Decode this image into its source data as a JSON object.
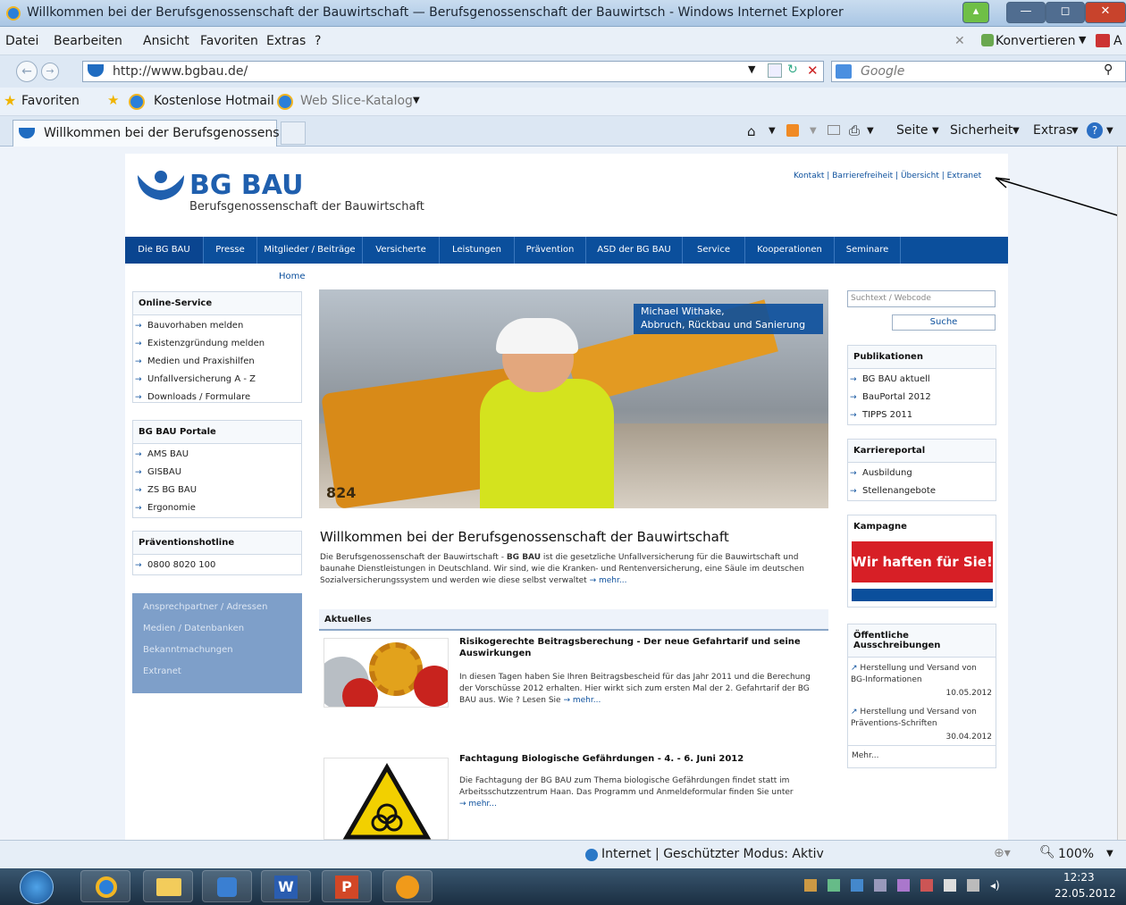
{
  "window": {
    "title": "Willkommen bei der Berufsgenossenschaft der Bauwirtschaft — Berufsgenossenschaft der Bauwirtsch - Windows Internet Explorer"
  },
  "menu": {
    "items": [
      "Datei",
      "Bearbeiten",
      "Ansicht",
      "Favoriten",
      "Extras",
      "?"
    ],
    "convert": "Konvertieren",
    "ad": "A"
  },
  "address": {
    "url": "http://www.bgbau.de/",
    "search_placeholder": "Google"
  },
  "favorites": {
    "label": "Favoriten",
    "hotmail": "Kostenlose Hotmail",
    "webslice": "Web Slice-Katalog"
  },
  "tab": {
    "title": "Willkommen bei der Berufsgenossens..."
  },
  "commandbar": {
    "seite": "Seite",
    "sicherheit": "Sicherheit",
    "extras": "Extras"
  },
  "site": {
    "logo_title": "BG BAU",
    "logo_sub": "Berufsgenossenschaft der Bauwirtschaft",
    "toplinks": "Kontakt | Barrierefreiheit | Übersicht | Extranet",
    "nav": [
      "Die BG BAU",
      "Presse",
      "Mitglieder / Beiträge",
      "Versicherte",
      "Leistungen",
      "Prävention",
      "ASD der BG BAU",
      "Service",
      "Kooperationen",
      "Seminare"
    ],
    "breadcrumb": "Home",
    "online_service": {
      "title": "Online-Service",
      "items": [
        "Bauvorhaben melden",
        "Existenzgründung melden",
        "Medien und Praxishilfen",
        "Unfallversicherung A - Z",
        "Downloads / Formulare"
      ]
    },
    "portale": {
      "title": "BG BAU Portale",
      "items": [
        "AMS BAU",
        "GISBAU",
        "ZS BG BAU",
        "Ergonomie"
      ]
    },
    "hotline": {
      "title": "Präventionshotline",
      "number": "0800 8020 100"
    },
    "bluelinks": [
      "Ansprechpartner / Adressen",
      "Medien / Datenbanken",
      "Bekanntmachungen",
      "Extranet"
    ],
    "hero": {
      "caption1": "Michael Withake,",
      "caption2": "Abbruch, Rückbau und Sanierung",
      "badge": "824"
    },
    "welcome": {
      "title": "Willkommen bei der Berufsgenossenschaft der Bauwirtschaft",
      "text_a": "Die Berufsgenossenschaft der Bauwirtschaft - ",
      "text_b": "BG BAU",
      "text_c": " ist die gesetzliche Unfallversicherung für die Bauwirtschaft und baunahe Dienstleistungen in Deutschland. Wir sind, wie die Kranken- und Rentenversicherung, eine Säule im deutschen Sozialversicherungssystem und werden wie diese selbst verwaltet",
      "more": "mehr..."
    },
    "aktuelles": {
      "title": "Aktuelles",
      "n1": {
        "title": "Risikogerechte Beitragsberechung - Der neue Gefahrtarif und seine Auswirkungen",
        "text": "In diesen Tagen haben Sie Ihren Beitragsbescheid für das Jahr 2011 und die Berechung der Vorschüsse 2012 erhalten. Hier wirkt sich zum ersten Mal der 2. Gefahrtarif der BG BAU aus. Wie ? Lesen Sie",
        "more": "mehr..."
      },
      "n2": {
        "title": "Fachtagung Biologische Gefährdungen - 4. - 6. Juni 2012",
        "text": "Die Fachtagung der BG BAU zum Thema biologische Gefährdungen findet statt im Arbeitsschutzzentrum Haan. Das Programm und Anmeldeformular finden Sie unter",
        "more": "mehr..."
      }
    },
    "search": {
      "placeholder": "Suchtext / Webcode",
      "button": "Suche"
    },
    "publikationen": {
      "title": "Publikationen",
      "items": [
        "BG BAU aktuell",
        "BauPortal 2012",
        "TIPPS 2011"
      ]
    },
    "karriere": {
      "title": "Karriereportal",
      "items": [
        "Ausbildung",
        "Stellenangebote"
      ]
    },
    "kampagne": {
      "title": "Kampagne",
      "banner": "Wir haften für Sie!"
    },
    "ausschreibungen": {
      "title": "Öffentliche Ausschreibungen",
      "i1": "Herstellung und Versand von BG-Informationen",
      "d1": "10.05.2012",
      "i2": "Herstellung und Versand von Präventions-Schriften",
      "d2": "30.04.2012",
      "more": "Mehr..."
    }
  },
  "status": {
    "zone": "Internet | Geschützter Modus: Aktiv",
    "zoom": "100%"
  },
  "clock": {
    "time": "12:23",
    "date": "22.05.2012"
  },
  "colors": {
    "brand": "#0b4f9c",
    "banner": "#d71f26"
  }
}
